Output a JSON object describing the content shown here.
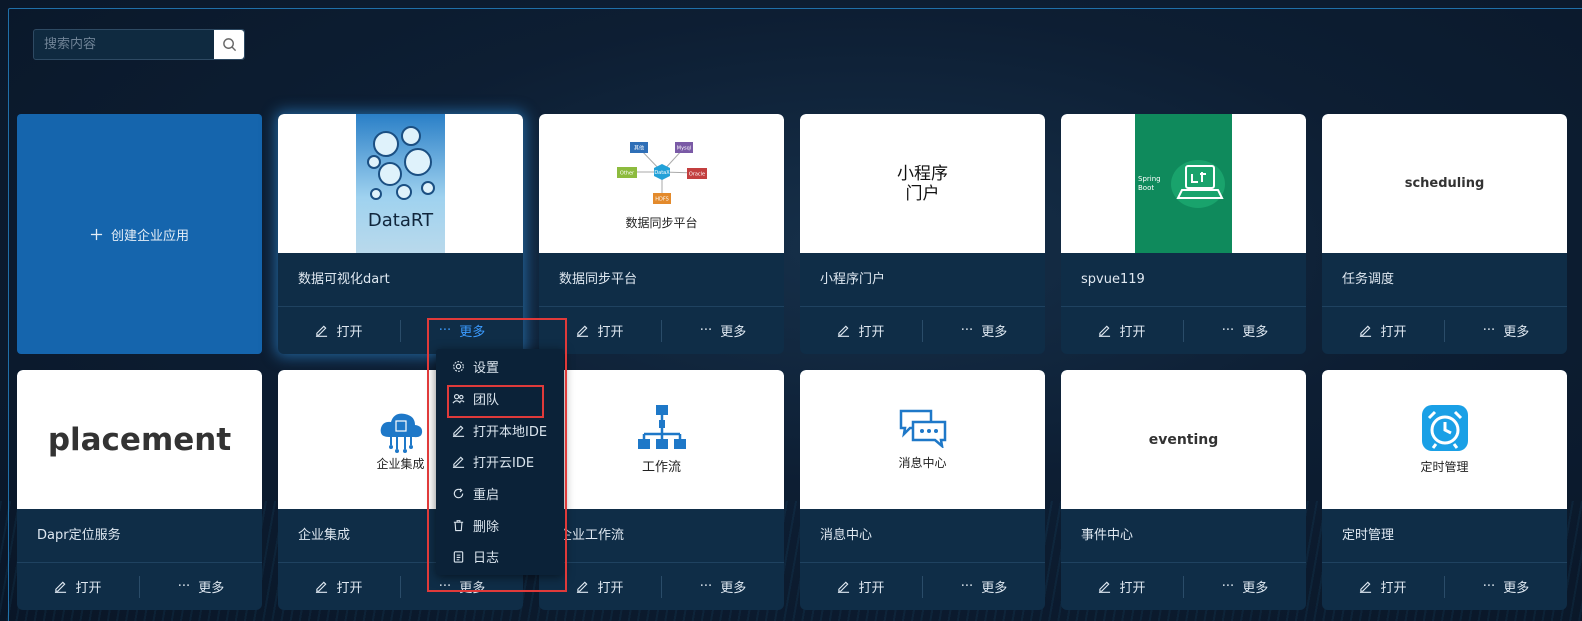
{
  "search": {
    "placeholder": "搜索内容"
  },
  "create": {
    "label": "创建企业应用"
  },
  "common": {
    "open_label": "打开",
    "more_label": "更多"
  },
  "row1": [
    {
      "name": "数据可视化dart",
      "thumb_text": "DataRT"
    },
    {
      "name": "数据同步平台",
      "thumb_text": "数据同步平台",
      "nodes": [
        "其他",
        "Mysql",
        "Other",
        "DataX",
        "Oracle",
        "HDFS"
      ]
    },
    {
      "name": "小程序门户",
      "thumb_line1": "小程序",
      "thumb_line2": "门户"
    },
    {
      "name": "spvue119",
      "thumb_text": "Spring Boot"
    },
    {
      "name": "任务调度",
      "thumb_text": "scheduling"
    }
  ],
  "row2": [
    {
      "name": "Dapr定位服务",
      "thumb_text": "placement"
    },
    {
      "name": "企业集成",
      "thumb_text": "企业集成"
    },
    {
      "name": "企业工作流",
      "thumb_text": "工作流"
    },
    {
      "name": "消息中心",
      "thumb_text": "消息中心"
    },
    {
      "name": "事件中心",
      "thumb_text": "eventing"
    },
    {
      "name": "定时管理",
      "thumb_text": "定时管理"
    }
  ],
  "menu": {
    "items": [
      {
        "label": "设置",
        "icon": "gear-icon"
      },
      {
        "label": "团队",
        "icon": "team-icon"
      },
      {
        "label": "打开本地IDE",
        "icon": "edit-icon"
      },
      {
        "label": "打开云IDE",
        "icon": "edit-icon"
      },
      {
        "label": "重启",
        "icon": "restart-icon"
      },
      {
        "label": "删除",
        "icon": "trash-icon"
      },
      {
        "label": "日志",
        "icon": "log-icon"
      }
    ]
  },
  "colors": {
    "accent": "#3b9bff",
    "create_bg": "#1565ad",
    "highlight": "#e03a3a",
    "card_bg": "#0f2d47"
  }
}
